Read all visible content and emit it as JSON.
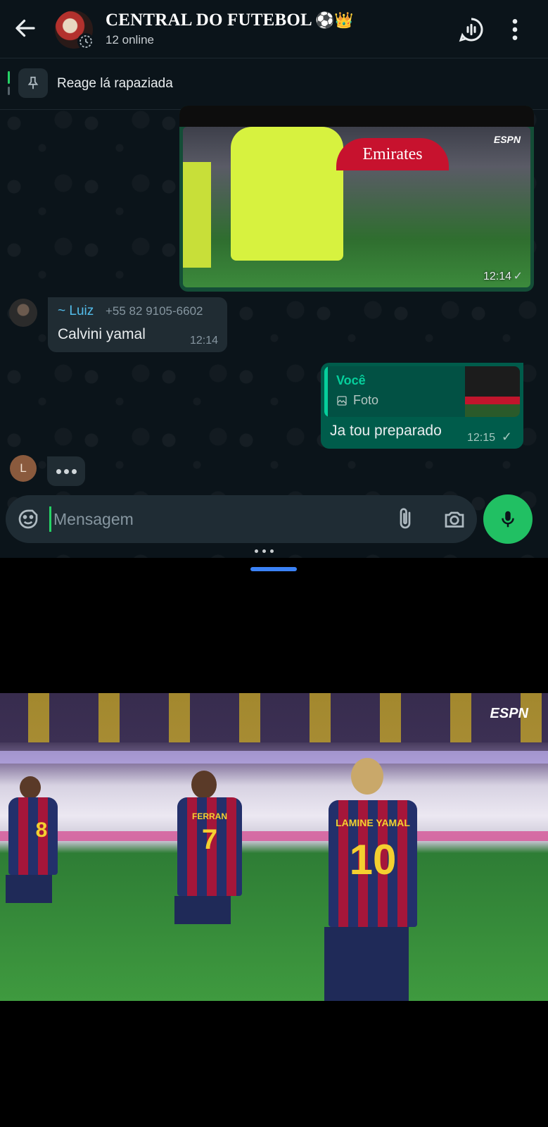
{
  "header": {
    "title": "CENTRAL DO FUTEBOL",
    "title_emoji": "⚽👑",
    "subtitle": "12 online",
    "icons": [
      "back-arrow-icon",
      "group-avatar",
      "voice-chat-icon",
      "more-vert-icon"
    ]
  },
  "pinned": {
    "text": "Reage lá rapaziada",
    "icon": "pin-icon"
  },
  "messages": {
    "video": {
      "time": "12:14",
      "status": "sent",
      "watermark": "ESPN",
      "sign_text": "Emirates"
    },
    "incoming": {
      "sender": "~ Luiz",
      "phone": "+55 82 9105-6602",
      "text": "Calvini yamal",
      "time": "12:14"
    },
    "outgoing": {
      "quote_author": "Você",
      "quote_type": "Foto",
      "text": "Ja tou preparado",
      "time": "12:15",
      "status": "sent"
    },
    "typing": {
      "avatar_letter": "L"
    }
  },
  "composer": {
    "placeholder": "Mensagem",
    "icons": [
      "sticker-icon",
      "attach-icon",
      "camera-icon",
      "mic-icon"
    ]
  },
  "video_player": {
    "watermark": "ESPN",
    "players": [
      {
        "number": "8",
        "name": ""
      },
      {
        "number": "7",
        "name": "FERRAN"
      },
      {
        "number": "10",
        "name": "LAMINE YAMAL"
      }
    ]
  },
  "colors": {
    "background": "#0b141a",
    "incoming_bubble": "#202c33",
    "outgoing_bubble": "#005c4b",
    "accent_green": "#25d366",
    "sender_name": "#53bdeb",
    "pane_handle": "#3b82f6"
  }
}
